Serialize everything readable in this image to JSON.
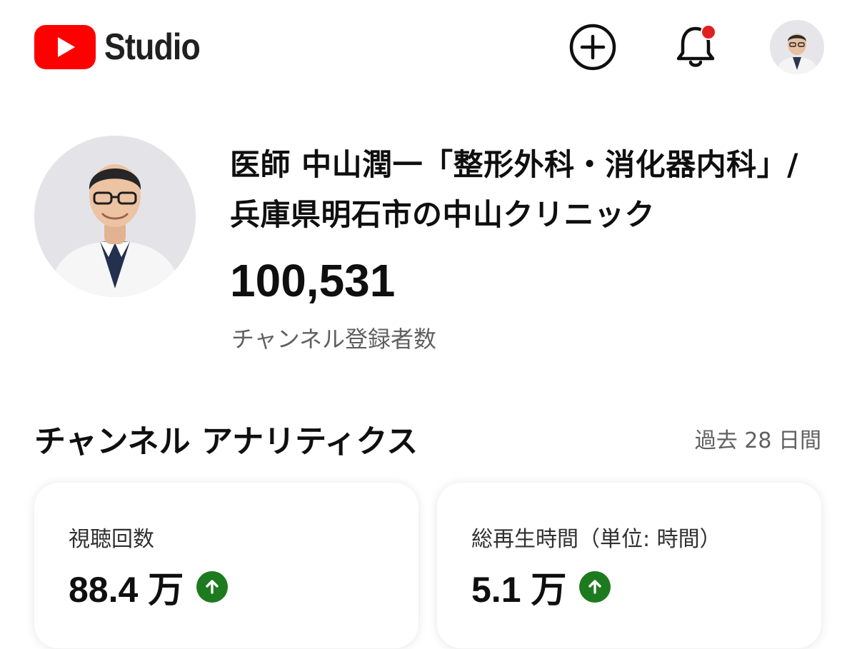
{
  "header": {
    "app_name": "Studio",
    "icons": {
      "logo": "youtube-play-icon",
      "create": "plus-circle-icon",
      "notifications": "bell-icon",
      "account": "avatar"
    },
    "brand_color": "#ff0000",
    "notification_dot_color": "#e02020"
  },
  "channel": {
    "name": "医師 中山潤一「整形外科・消化器内科」/ 兵庫県明石市の中山クリニック",
    "subscriber_count": "100,531",
    "subscriber_label": "チャンネル登録者数"
  },
  "analytics": {
    "title": "チャンネル アナリティクス",
    "period": "過去 28 日間",
    "cards": [
      {
        "label": "視聴回数",
        "value": "88.4 万",
        "trend": "up",
        "trend_icon": "arrow-up-icon"
      },
      {
        "label": "総再生時間（単位: 時間）",
        "value": "5.1 万",
        "trend": "up",
        "trend_icon": "arrow-up-icon"
      }
    ],
    "trend_color": "#1e7a1e"
  }
}
